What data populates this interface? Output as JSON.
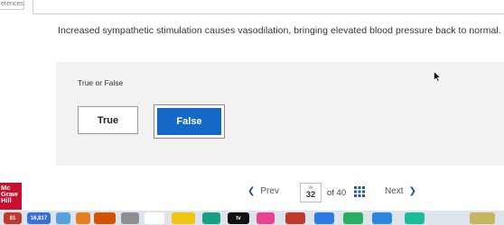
{
  "side_tab": {
    "label": "erences"
  },
  "question": {
    "text": "Increased sympathetic stimulation causes vasodilation, bringing elevated blood pressure back to normal."
  },
  "panel": {
    "label": "True or False"
  },
  "options": [
    {
      "label": "True",
      "selected": false
    },
    {
      "label": "False",
      "selected": true
    }
  ],
  "brand": {
    "logo_lines": [
      "Mc",
      "Graw",
      "Hill"
    ],
    "color": "#c8102e"
  },
  "navigation": {
    "prev_label": "Prev",
    "current_page": "32",
    "of_text": "of 40",
    "next_label": "Next"
  },
  "dock": {
    "items": [
      {
        "name": "dock-app-1",
        "badge": "81",
        "color": "#c0392b"
      },
      {
        "name": "dock-app-2",
        "badge": "16,817",
        "color": "#3a6fd8"
      },
      {
        "name": "dock-app-3",
        "badge": "",
        "color": "#5aa0e0"
      },
      {
        "name": "dock-app-4",
        "badge": "",
        "color": "#e67e22"
      },
      {
        "name": "dock-app-5",
        "badge": "",
        "color": "#d35400"
      },
      {
        "name": "dock-app-6",
        "badge": "",
        "color": "#8e8e8e"
      },
      {
        "name": "dock-app-7",
        "badge": "",
        "color": "#ffffff"
      },
      {
        "name": "dock-app-8",
        "badge": "",
        "color": "#f1c40f"
      },
      {
        "name": "dock-app-9",
        "badge": "",
        "color": "#16a085"
      },
      {
        "name": "dock-app-10",
        "badge": "tv",
        "color": "#111111"
      },
      {
        "name": "dock-app-11",
        "badge": "",
        "color": "#e84393"
      },
      {
        "name": "dock-app-12",
        "badge": "",
        "color": "#c0392b"
      },
      {
        "name": "dock-app-13",
        "badge": "",
        "color": "#2c7be5"
      },
      {
        "name": "dock-app-14",
        "badge": "",
        "color": "#27ae60"
      },
      {
        "name": "dock-app-15",
        "badge": "",
        "color": "#2e86de"
      },
      {
        "name": "dock-app-16",
        "badge": "",
        "color": "#1abc9c"
      },
      {
        "name": "dock-app-17",
        "badge": "",
        "color": "#c8b560"
      }
    ]
  }
}
